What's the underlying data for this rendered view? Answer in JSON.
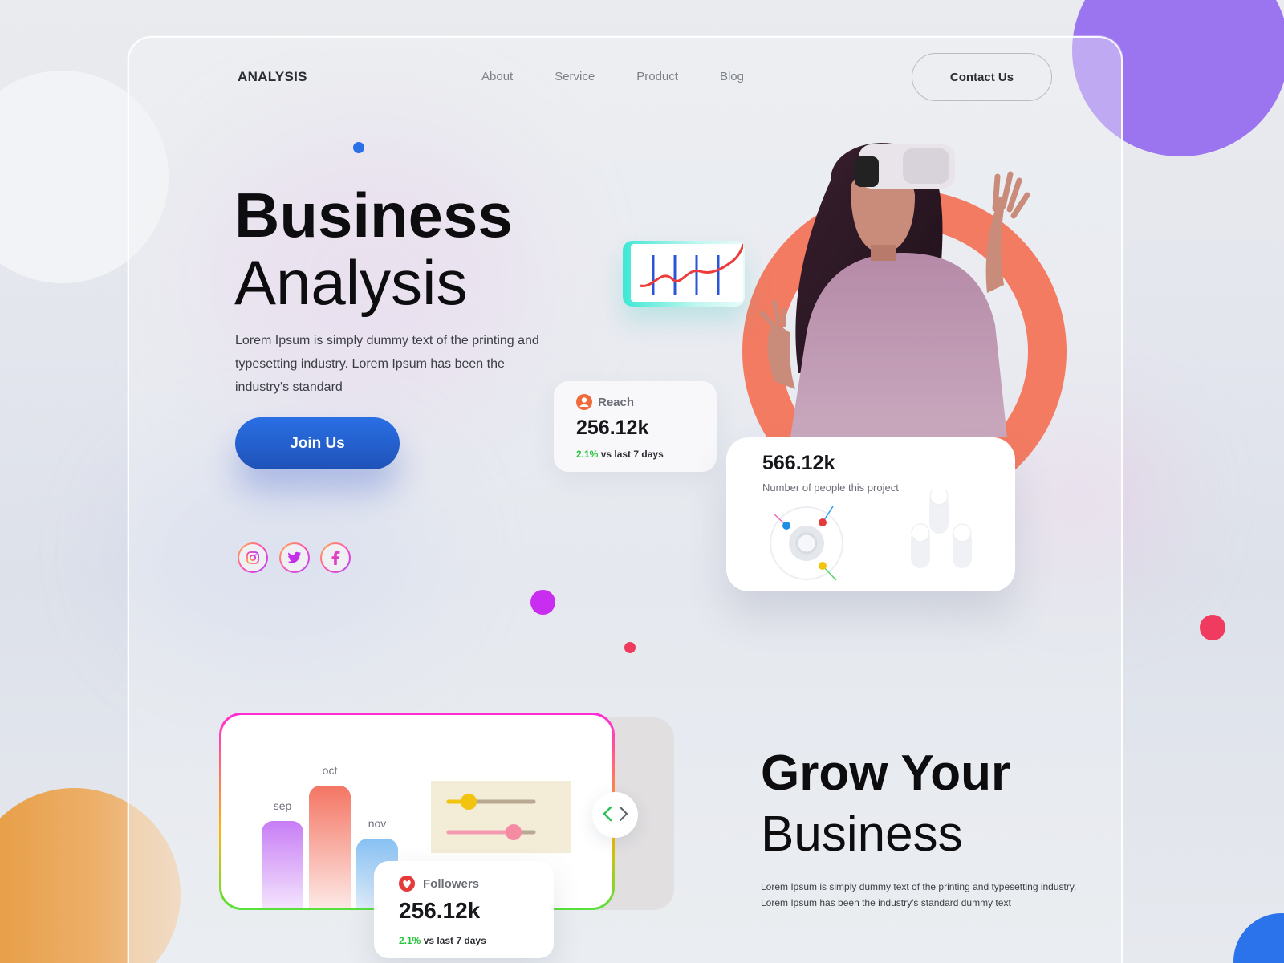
{
  "nav": {
    "logo": "ANALYSIS",
    "links": [
      "About",
      "Service",
      "Product",
      "Blog"
    ],
    "contact_label": "Contact Us"
  },
  "hero": {
    "title_bold": "Business",
    "title_light": "Analysis",
    "description": "Lorem Ipsum is simply dummy text of the printing and typesetting industry. Lorem Ipsum has been the industry's standard",
    "cta_label": "Join Us",
    "socials": [
      "instagram-icon",
      "twitter-icon",
      "facebook-icon"
    ]
  },
  "reach_card": {
    "label": "Reach",
    "value": "256.12k",
    "change": "2.1%",
    "change_suffix": " vs last 7 days"
  },
  "stats_card": {
    "value": "566.12k",
    "label": "Number of people this project"
  },
  "bar_chart": {
    "categories": [
      "sep",
      "oct",
      "nov"
    ],
    "values": [
      118,
      162,
      96
    ],
    "colors": [
      "#c77df5",
      "#f47563",
      "#86c0f2"
    ]
  },
  "followers_card": {
    "label": "Followers",
    "value": "256.12k",
    "change": "2.1%",
    "change_suffix": " vs last 7 days"
  },
  "grow": {
    "title_bold": "Grow Your",
    "title_light": "Business",
    "description": "Lorem Ipsum is simply dummy text of the printing and typesetting industry. Lorem Ipsum has been the industry's standard dummy text"
  },
  "colors": {
    "accent_blue": "#2a6fe4",
    "accent_orange": "#f37b62",
    "positive": "#26c23c"
  }
}
